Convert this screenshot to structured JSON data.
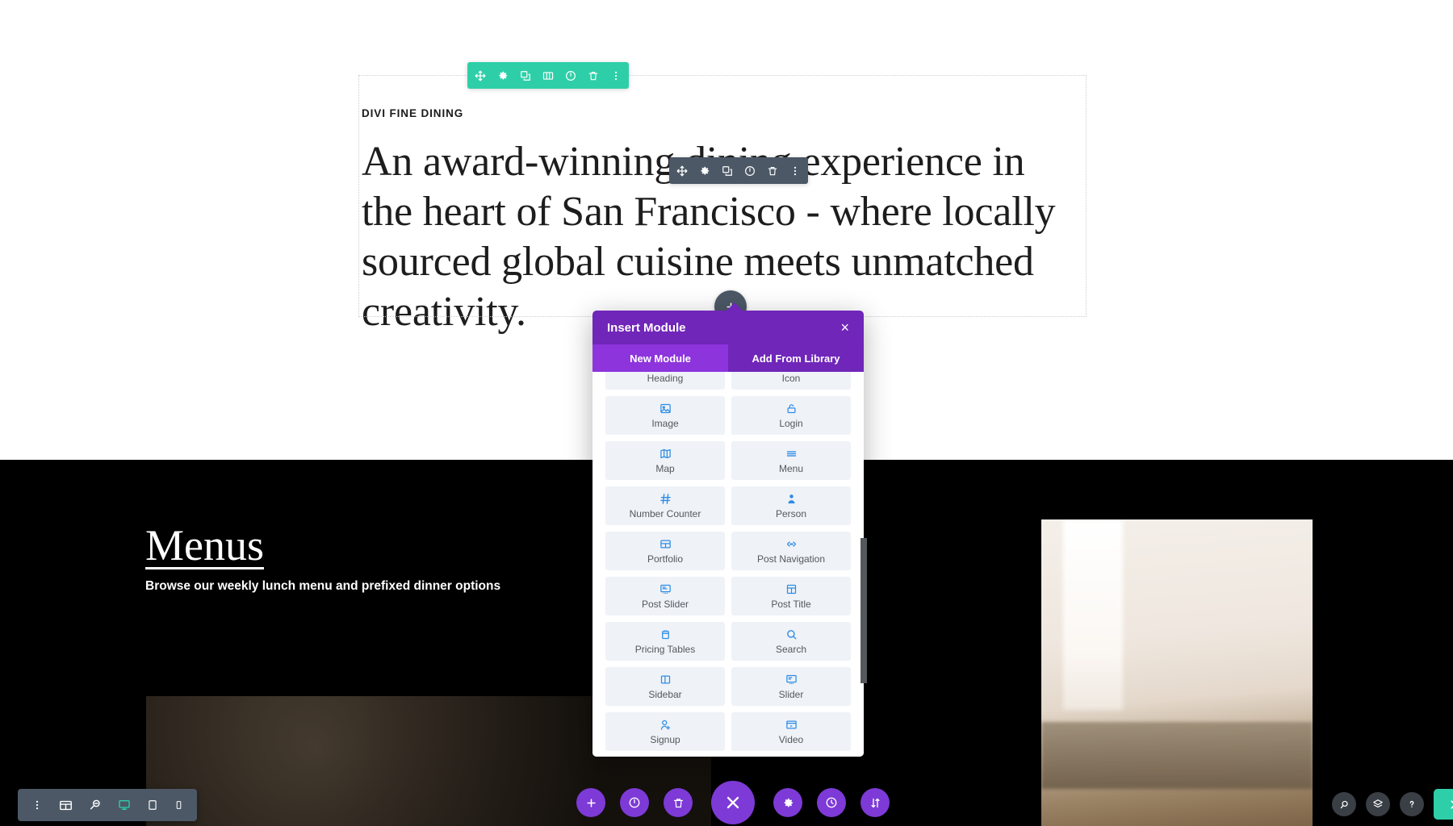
{
  "page": {
    "hero": {
      "eyebrow": "DIVI FINE DINING",
      "heading": "An award-winning dining experience in the heart of San Francisco - where locally sourced global cuisine meets unmatched creativity."
    },
    "menus_section": {
      "title": "Menus",
      "subtitle": "Browse our weekly lunch menu and prefixed dinner options"
    }
  },
  "row_toolbar": {
    "color": "#2ecfa8",
    "buttons": [
      {
        "name": "move-icon",
        "label": "Move Row"
      },
      {
        "name": "gear-icon",
        "label": "Row Settings"
      },
      {
        "name": "duplicate-icon",
        "label": "Duplicate Row"
      },
      {
        "name": "columns-icon",
        "label": "Change Column Structure"
      },
      {
        "name": "power-icon",
        "label": "Disable Row"
      },
      {
        "name": "trash-icon",
        "label": "Delete Row"
      },
      {
        "name": "kebab-icon",
        "label": "More Options"
      }
    ]
  },
  "module_toolbar": {
    "color": "#4c5866",
    "buttons": [
      {
        "name": "move-icon",
        "label": "Move Module"
      },
      {
        "name": "gear-icon",
        "label": "Module Settings"
      },
      {
        "name": "duplicate-icon",
        "label": "Duplicate Module"
      },
      {
        "name": "power-icon",
        "label": "Disable Module"
      },
      {
        "name": "trash-icon",
        "label": "Delete Module"
      },
      {
        "name": "kebab-icon",
        "label": "More Options"
      }
    ]
  },
  "insert_modal": {
    "title": "Insert Module",
    "close_label": "×",
    "accent": "#7026b9",
    "accent_active": "#8d34dd",
    "tabs": [
      {
        "label": "New Module",
        "active": true
      },
      {
        "label": "Add From Library",
        "active": false
      }
    ],
    "modules": [
      {
        "label": "Heading",
        "icon": "heading-icon"
      },
      {
        "label": "Icon",
        "icon": "icon-target-icon"
      },
      {
        "label": "Image",
        "icon": "image-icon"
      },
      {
        "label": "Login",
        "icon": "lock-icon"
      },
      {
        "label": "Map",
        "icon": "map-icon"
      },
      {
        "label": "Menu",
        "icon": "menu-lines-icon"
      },
      {
        "label": "Number Counter",
        "icon": "hash-icon"
      },
      {
        "label": "Person",
        "icon": "person-icon"
      },
      {
        "label": "Portfolio",
        "icon": "grid-icon"
      },
      {
        "label": "Post Navigation",
        "icon": "code-arrows-icon"
      },
      {
        "label": "Post Slider",
        "icon": "post-slider-icon"
      },
      {
        "label": "Post Title",
        "icon": "post-title-icon"
      },
      {
        "label": "Pricing Tables",
        "icon": "pricing-tables-icon"
      },
      {
        "label": "Search",
        "icon": "search-icon"
      },
      {
        "label": "Sidebar",
        "icon": "sidebar-icon"
      },
      {
        "label": "Slider",
        "icon": "slider-icon"
      },
      {
        "label": "Signup",
        "icon": "person-add-icon"
      },
      {
        "label": "Video",
        "icon": "video-icon"
      }
    ]
  },
  "view_bar": {
    "items": [
      {
        "name": "kebab-icon",
        "label": "More Settings",
        "active": false
      },
      {
        "name": "wireframe-icon",
        "label": "Wireframe View",
        "active": false
      },
      {
        "name": "zoom-out-icon",
        "label": "Zoom Out View",
        "active": false
      },
      {
        "name": "desktop-icon",
        "label": "Desktop View",
        "active": true
      },
      {
        "name": "tablet-icon",
        "label": "Tablet View",
        "active": false
      },
      {
        "name": "phone-icon",
        "label": "Phone View",
        "active": false
      }
    ]
  },
  "center_bar": {
    "accent": "#7d3ad6",
    "items": [
      {
        "name": "plus-icon",
        "label": "Add Section",
        "size": "sm"
      },
      {
        "name": "power-icon",
        "label": "Disable",
        "size": "sm"
      },
      {
        "name": "trash-icon",
        "label": "Delete",
        "size": "sm"
      },
      {
        "name": "close-x-icon",
        "label": "Close Builder Menu",
        "size": "lg"
      },
      {
        "name": "gear-icon",
        "label": "Page Settings",
        "size": "sm"
      },
      {
        "name": "history-icon",
        "label": "Editing History",
        "size": "sm"
      },
      {
        "name": "updown-arrows-icon",
        "label": "Portability",
        "size": "sm"
      }
    ]
  },
  "right_bar": {
    "accent": "#2ecfa8",
    "items": [
      {
        "name": "search-icon",
        "label": "Search"
      },
      {
        "name": "layers-icon",
        "label": "Layers View"
      },
      {
        "name": "help-icon",
        "label": "Help"
      }
    ],
    "primary": {
      "name": "close-icon",
      "label": "Exit"
    }
  }
}
